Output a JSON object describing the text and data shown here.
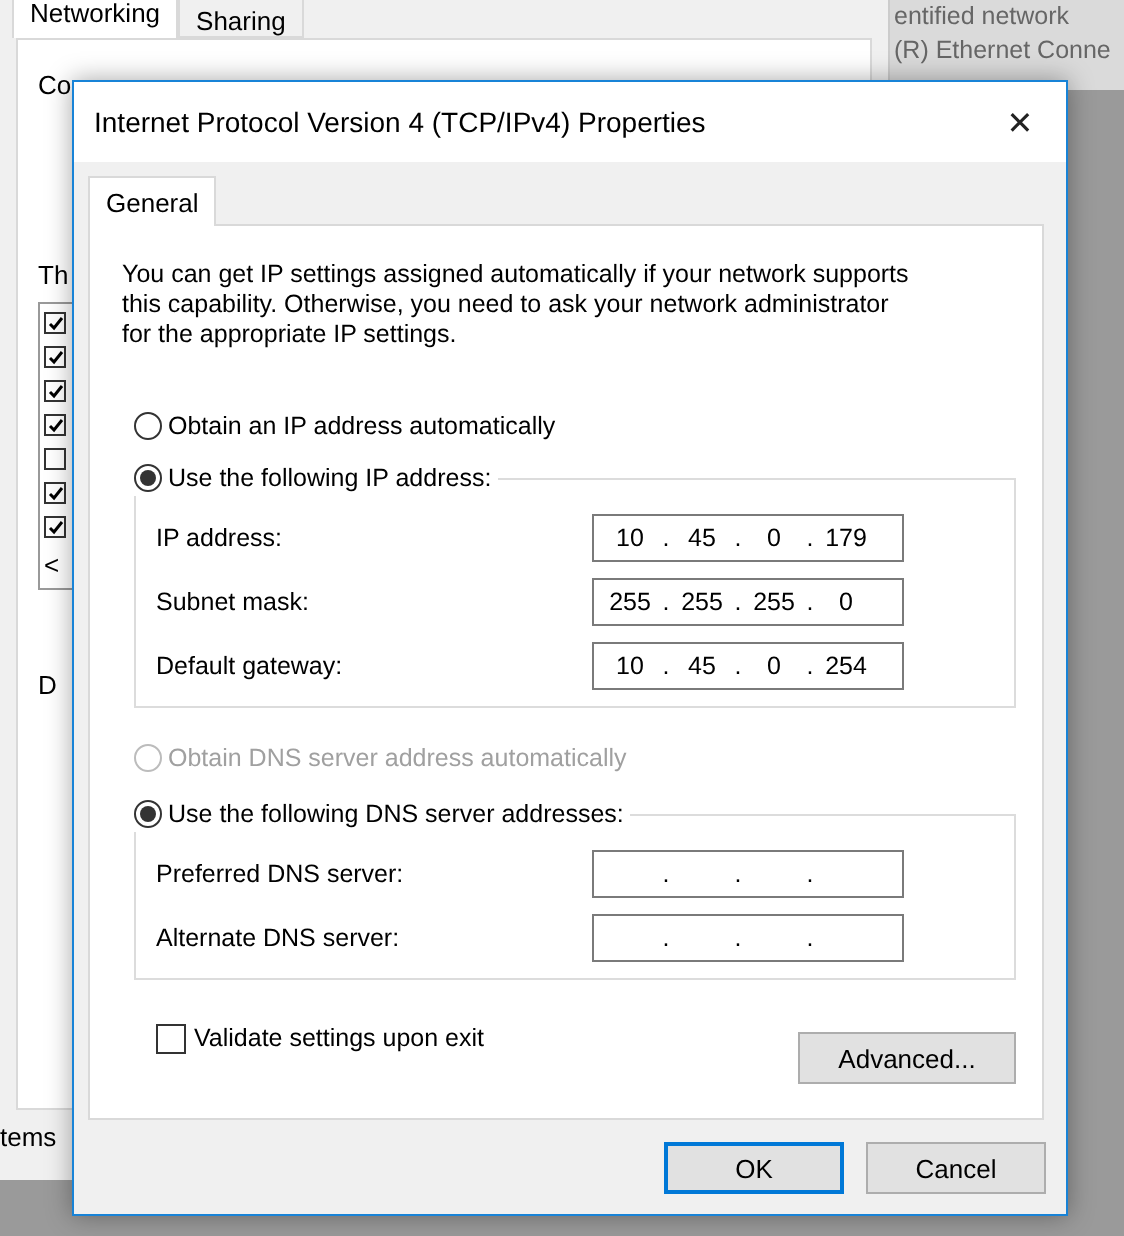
{
  "background_window": {
    "tabs": [
      {
        "label": "Networking",
        "selected": true
      },
      {
        "label": "Sharing",
        "selected": false
      }
    ],
    "connect_label": "Co",
    "components_label": "Th",
    "components": [
      {
        "checked": true
      },
      {
        "checked": true
      },
      {
        "checked": true
      },
      {
        "checked": true
      },
      {
        "checked": false
      },
      {
        "checked": true
      },
      {
        "checked": true
      }
    ],
    "scroll_arrow": "<",
    "detail_label": "D",
    "footer_text": "tems"
  },
  "background_info": [
    "entified network",
    "(R) Ethernet Conne"
  ],
  "dialog": {
    "title": "Internet Protocol Version 4 (TCP/IPv4) Properties",
    "close": "✕",
    "tabs": [
      {
        "label": "General",
        "selected": true
      }
    ],
    "intro": "You can get IP settings assigned automatically if your network supports\nthis capability. Otherwise, you need to ask your network administrator\nfor the appropriate IP settings.",
    "ip_mode": [
      {
        "label": "Obtain an IP address automatically",
        "selected": false,
        "disabled": false
      },
      {
        "label": "Use the following IP address:",
        "selected": true,
        "disabled": false
      }
    ],
    "ip_fields": [
      {
        "label": "IP address:",
        "separator": ".",
        "octets": [
          "10",
          "45",
          "0",
          "179"
        ]
      },
      {
        "label": "Subnet mask:",
        "separator": ".",
        "octets": [
          "255",
          "255",
          "255",
          "0"
        ]
      },
      {
        "label": "Default gateway:",
        "separator": ".",
        "octets": [
          "10",
          "45",
          "0",
          "254"
        ]
      }
    ],
    "dns_mode": [
      {
        "label": "Obtain DNS server address automatically",
        "selected": false,
        "disabled": true
      },
      {
        "label": "Use the following DNS server addresses:",
        "selected": true,
        "disabled": false
      }
    ],
    "dns_fields": [
      {
        "label": "Preferred DNS server:",
        "separator": "."
      },
      {
        "label": "Alternate DNS server:",
        "separator": "."
      }
    ],
    "validate": {
      "label": "Validate settings upon exit",
      "checked": false
    },
    "advanced": "Advanced...",
    "buttons": [
      {
        "label": "OK",
        "default": true
      },
      {
        "label": "Cancel",
        "default": false
      }
    ]
  }
}
